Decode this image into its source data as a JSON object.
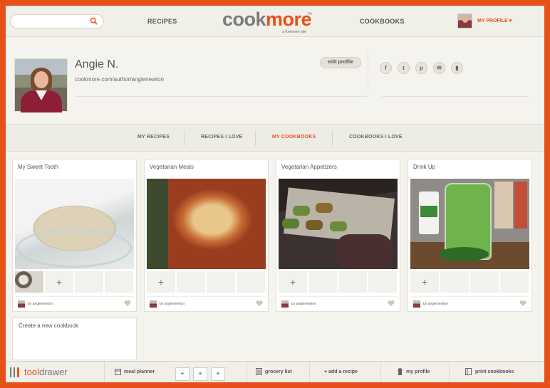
{
  "header": {
    "search_placeholder": "",
    "nav_recipes": "RECIPES",
    "logo_cook": "cook",
    "logo_more": "more",
    "logo_tm": "TM",
    "logo_tagline": "a Kenmore site",
    "nav_cookbooks": "COOKBOOKS",
    "my_profile": "MY PROFILE ▾"
  },
  "profile": {
    "name": "Angie N.",
    "url": "cookmore.com/author/angienewton",
    "edit_profile": "edit profile",
    "social": [
      "f",
      "t",
      "p",
      "✉",
      "▮"
    ]
  },
  "tabs": [
    {
      "label": "MY RECIPES",
      "active": false
    },
    {
      "label": "RECIPES I LOVE",
      "active": false
    },
    {
      "label": "MY COOKBOOKS",
      "active": true
    },
    {
      "label": "COOKBOOKS I LOVE",
      "active": false
    }
  ],
  "cookbooks": [
    {
      "title": "My Sweet Tooth",
      "by": "by angienewton",
      "plus": "+"
    },
    {
      "title": "Vegetarian Meals",
      "by": "by angienewton",
      "plus": "+"
    },
    {
      "title": "Vegetarian Appetizers",
      "by": "by angienewton",
      "plus": "+"
    },
    {
      "title": "Drink Up",
      "by": "by angienewton",
      "plus": "+"
    }
  ],
  "new_cookbook": "Create a new cookbook",
  "drawer": {
    "logo_tool": "tool",
    "logo_drawer": "drawer",
    "meal_planner": "meal planner",
    "slot_plus": "+",
    "grocery_list": "grocery list",
    "add_recipe": "+ add a recipe",
    "my_profile": "my profile",
    "print_cookbooks": "print cookbooks"
  },
  "colors": {
    "accent": "#e8501a",
    "border_frame": "#e8501a",
    "background": "#f4f3ee"
  }
}
